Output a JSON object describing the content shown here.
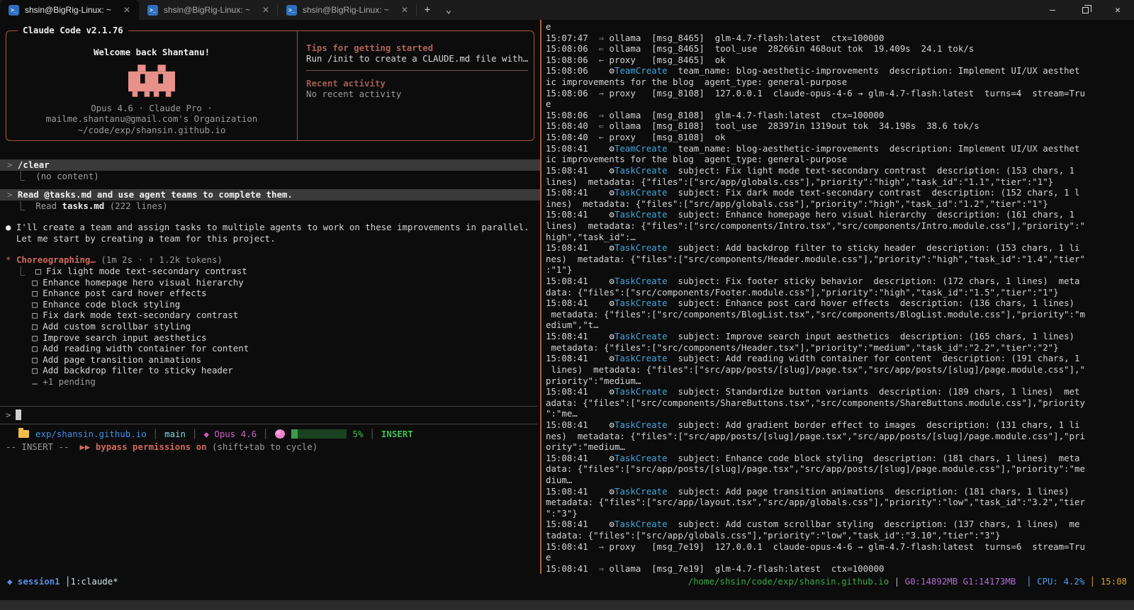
{
  "window": {
    "tabs": [
      {
        "title": "shsin@BigRig-Linux: ~",
        "active": true
      },
      {
        "title": "shsin@BigRig-Linux: ~",
        "active": false
      },
      {
        "title": "shsin@BigRig-Linux: ~",
        "active": false
      }
    ],
    "new_tab_label": "+",
    "tab_dropdown_label": "⌄",
    "minimize_label": "—",
    "close_label": "✕"
  },
  "icons": {
    "tab_terminal_icon": ">_",
    "prompt_chevron": ">",
    "result_elbow": "⎿",
    "assistant_bullet": "●",
    "spinner_star": "*",
    "task_checkbox": "□",
    "model_star": "◆",
    "session_diamond": "◆",
    "bypass_arrows": "▶▶"
  },
  "claude_box": {
    "title": "Claude Code v2.1.76",
    "welcome": "Welcome back Shantanu!",
    "model_line": "Opus 4.6 · Claude Pro ·",
    "org_line": "mailme.shantanu@gmail.com's Organization",
    "path_line": "~/code/exp/shansin.github.io",
    "tips_heading": "Tips for getting started",
    "tips_line": "Run /init to create a CLAUDE.md file with…",
    "recent_heading": "Recent activity",
    "recent_line": "No recent activity",
    "accent_color": "#a85340",
    "logo_color": "#e8908a"
  },
  "transcript": {
    "cmd1": "/clear",
    "cmd1_result": "(no content)",
    "cmd2": "Read @tasks.md and use agent teams to complete them.",
    "cmd2_result_prefix": "Read ",
    "cmd2_result_file": "tasks.md",
    "cmd2_result_suffix": " (222 lines)",
    "assistant_line1": "I'll create a team and assign tasks to multiple agents to work on these improvements in parallel.",
    "assistant_line2": "Let me start by creating a team for this project.",
    "spinner_verb": "Choreographing…",
    "spinner_meta": "(1m 2s · ↑ 1.2k tokens)",
    "tasks": [
      "Fix light mode text-secondary contrast",
      "Enhance homepage hero visual hierarchy",
      "Enhance post card hover effects",
      "Enhance code block styling",
      "Fix dark mode text-secondary contrast",
      "Add custom scrollbar styling",
      "Improve search input aesthetics",
      "Add reading width container for content",
      "Add page transition animations",
      "Add backdrop filter to sticky header"
    ],
    "tasks_more": "… +1 pending"
  },
  "statusline": {
    "repo": "exp/shansin.github.io",
    "branch": "main",
    "model": "Opus 4.6",
    "context_pct": "5%",
    "mode": "INSERT",
    "vim_mode": "-- INSERT --",
    "permissions": "bypass permissions on",
    "permissions_hint": "(shift+tab to cycle)",
    "accent_green": "#3fbf55",
    "accent_blue": "#3f8fe8",
    "accent_magenta": "#cf5fc4"
  },
  "tmux_bar": {
    "session": "session1",
    "window": "1:claude*",
    "path": "/home/shsin/code/exp/shansin.github.io",
    "gpu": "G0:14892MB G1:14173MB",
    "cpu": "CPU: 4.2%",
    "time": "15:08"
  },
  "log": {
    "lines": [
      [
        [
          "e",
          "fg"
        ]
      ],
      [
        [
          "15:07:47  ",
          "fg"
        ],
        [
          "⇒ ",
          "dim"
        ],
        [
          "ollama  [msg_8465]  glm-4.7-flash:latest  ctx=100000",
          "fg"
        ]
      ],
      [
        [
          "15:08:06  ",
          "fg"
        ],
        [
          "⇐ ",
          "dim"
        ],
        [
          "ollama  [msg_8465]  tool_use  28266in 468out tok  19.409s  24.1 tok/s",
          "fg"
        ]
      ],
      [
        [
          "15:08:06  ",
          "fg"
        ],
        [
          "← ",
          "dim"
        ],
        [
          "proxy   [msg_8465]  ok",
          "fg"
        ]
      ],
      [
        [
          "15:08:06    ",
          "fg"
        ],
        [
          "⚙",
          "gear"
        ],
        [
          "TeamCreate",
          "tool"
        ],
        [
          "  team_name: blog-aesthetic-improvements  description: Implement UI/UX aesthet",
          "fg"
        ]
      ],
      [
        [
          "ic improvements for the blog  agent_type: general-purpose",
          "fg"
        ]
      ],
      [
        [
          "15:08:06  ",
          "fg"
        ],
        [
          "→ ",
          "dim"
        ],
        [
          "proxy   [msg_8108]  127.0.0.1  claude-opus-4-6 → glm-4.7-flash:latest  turns=4  stream=Tru",
          "fg"
        ]
      ],
      [
        [
          "e",
          "fg"
        ]
      ],
      [
        [
          "15:08:06  ",
          "fg"
        ],
        [
          "⇒ ",
          "dim"
        ],
        [
          "ollama  [msg_8108]  glm-4.7-flash:latest  ctx=100000",
          "fg"
        ]
      ],
      [
        [
          "15:08:40  ",
          "fg"
        ],
        [
          "⇐ ",
          "dim"
        ],
        [
          "ollama  [msg_8108]  tool_use  28397in 1319out tok  34.198s  38.6 tok/s",
          "fg"
        ]
      ],
      [
        [
          "15:08:40  ",
          "fg"
        ],
        [
          "← ",
          "dim"
        ],
        [
          "proxy   [msg_8108]  ok",
          "fg"
        ]
      ],
      [
        [
          "15:08:41    ",
          "fg"
        ],
        [
          "⚙",
          "gear"
        ],
        [
          "TeamCreate",
          "tool"
        ],
        [
          "  team_name: blog-aesthetic-improvements  description: Implement UI/UX aesthet",
          "fg"
        ]
      ],
      [
        [
          "ic improvements for the blog  agent_type: general-purpose",
          "fg"
        ]
      ],
      [
        [
          "15:08:41    ",
          "fg"
        ],
        [
          "⚙",
          "gear"
        ],
        [
          "TaskCreate",
          "tool"
        ],
        [
          "  subject: Fix light mode text-secondary contrast  description: (153 chars, 1",
          "fg"
        ]
      ],
      [
        [
          "lines)  metadata: {\"files\":[\"src/app/globals.css\"],\"priority\":\"high\",\"task_id\":\"1.1\",\"tier\":\"1\"}",
          "fg"
        ]
      ],
      [
        [
          "15:08:41    ",
          "fg"
        ],
        [
          "⚙",
          "gear"
        ],
        [
          "TaskCreate",
          "tool"
        ],
        [
          "  subject: Fix dark mode text-secondary contrast  description: (152 chars, 1 l",
          "fg"
        ]
      ],
      [
        [
          "ines)  metadata: {\"files\":[\"src/app/globals.css\"],\"priority\":\"high\",\"task_id\":\"1.2\",\"tier\":\"1\"}",
          "fg"
        ]
      ],
      [
        [
          "15:08:41    ",
          "fg"
        ],
        [
          "⚙",
          "gear"
        ],
        [
          "TaskCreate",
          "tool"
        ],
        [
          "  subject: Enhance homepage hero visual hierarchy  description: (161 chars, 1",
          "fg"
        ]
      ],
      [
        [
          "lines)  metadata: {\"files\":[\"src/components/Intro.tsx\",\"src/components/Intro.module.css\"],\"priority\":\"",
          "fg"
        ]
      ],
      [
        [
          "high\",\"task_id\":…",
          "fg"
        ]
      ],
      [
        [
          "15:08:41    ",
          "fg"
        ],
        [
          "⚙",
          "gear"
        ],
        [
          "TaskCreate",
          "tool"
        ],
        [
          "  subject: Add backdrop filter to sticky header  description: (153 chars, 1 li",
          "fg"
        ]
      ],
      [
        [
          "nes)  metadata: {\"files\":[\"src/components/Header.module.css\"],\"priority\":\"high\",\"task_id\":\"1.4\",\"tier\"",
          "fg"
        ]
      ],
      [
        [
          ":\"1\"}",
          "fg"
        ]
      ],
      [
        [
          "15:08:41    ",
          "fg"
        ],
        [
          "⚙",
          "gear"
        ],
        [
          "TaskCreate",
          "tool"
        ],
        [
          "  subject: Fix footer sticky behavior  description: (172 chars, 1 lines)  meta",
          "fg"
        ]
      ],
      [
        [
          "data: {\"files\":[\"src/components/Footer.module.css\"],\"priority\":\"high\",\"task_id\":\"1.5\",\"tier\":\"1\"}",
          "fg"
        ]
      ],
      [
        [
          "15:08:41    ",
          "fg"
        ],
        [
          "⚙",
          "gear"
        ],
        [
          "TaskCreate",
          "tool"
        ],
        [
          "  subject: Enhance post card hover effects  description: (136 chars, 1 lines)",
          "fg"
        ]
      ],
      [
        [
          " metadata: {\"files\":[\"src/components/BlogList.tsx\",\"src/components/BlogList.module.css\"],\"priority\":\"m",
          "fg"
        ]
      ],
      [
        [
          "edium\",\"t…",
          "fg"
        ]
      ],
      [
        [
          "15:08:41    ",
          "fg"
        ],
        [
          "⚙",
          "gear"
        ],
        [
          "TaskCreate",
          "tool"
        ],
        [
          "  subject: Improve search input aesthetics  description: (165 chars, 1 lines)",
          "fg"
        ]
      ],
      [
        [
          " metadata: {\"files\":[\"src/components/Header.tsx\"],\"priority\":\"medium\",\"task_id\":\"2.2\",\"tier\":\"2\"}",
          "fg"
        ]
      ],
      [
        [
          "15:08:41    ",
          "fg"
        ],
        [
          "⚙",
          "gear"
        ],
        [
          "TaskCreate",
          "tool"
        ],
        [
          "  subject: Add reading width container for content  description: (191 chars, 1",
          "fg"
        ]
      ],
      [
        [
          " lines)  metadata: {\"files\":[\"src/app/posts/[slug]/page.tsx\",\"src/app/posts/[slug]/page.module.css\"],\"",
          "fg"
        ]
      ],
      [
        [
          "priority\":\"medium…",
          "fg"
        ]
      ],
      [
        [
          "15:08:41    ",
          "fg"
        ],
        [
          "⚙",
          "gear"
        ],
        [
          "TaskCreate",
          "tool"
        ],
        [
          "  subject: Standardize button variants  description: (189 chars, 1 lines)  met",
          "fg"
        ]
      ],
      [
        [
          "adata: {\"files\":[\"src/components/ShareButtons.tsx\",\"src/components/ShareButtons.module.css\"],\"priority",
          "fg"
        ]
      ],
      [
        [
          "\":\"me…",
          "fg"
        ]
      ],
      [
        [
          "15:08:41    ",
          "fg"
        ],
        [
          "⚙",
          "gear"
        ],
        [
          "TaskCreate",
          "tool"
        ],
        [
          "  subject: Add gradient border effect to images  description: (131 chars, 1 li",
          "fg"
        ]
      ],
      [
        [
          "nes)  metadata: {\"files\":[\"src/app/posts/[slug]/page.tsx\",\"src/app/posts/[slug]/page.module.css\"],\"pri",
          "fg"
        ]
      ],
      [
        [
          "ority\":\"medium…",
          "fg"
        ]
      ],
      [
        [
          "15:08:41    ",
          "fg"
        ],
        [
          "⚙",
          "gear"
        ],
        [
          "TaskCreate",
          "tool"
        ],
        [
          "  subject: Enhance code block styling  description: (181 chars, 1 lines)  meta",
          "fg"
        ]
      ],
      [
        [
          "data: {\"files\":[\"src/app/posts/[slug]/page.tsx\",\"src/app/posts/[slug]/page.module.css\"],\"priority\":\"me",
          "fg"
        ]
      ],
      [
        [
          "dium…",
          "fg"
        ]
      ],
      [
        [
          "15:08:41    ",
          "fg"
        ],
        [
          "⚙",
          "gear"
        ],
        [
          "TaskCreate",
          "tool"
        ],
        [
          "  subject: Add page transition animations  description: (181 chars, 1 lines)",
          "fg"
        ]
      ],
      [
        [
          "metadata: {\"files\":[\"src/app/layout.tsx\",\"src/app/globals.css\"],\"priority\":\"low\",\"task_id\":\"3.2\",\"tier",
          "fg"
        ]
      ],
      [
        [
          "\":\"3\"}",
          "fg"
        ]
      ],
      [
        [
          "15:08:41    ",
          "fg"
        ],
        [
          "⚙",
          "gear"
        ],
        [
          "TaskCreate",
          "tool"
        ],
        [
          "  subject: Add custom scrollbar styling  description: (137 chars, 1 lines)  me",
          "fg"
        ]
      ],
      [
        [
          "tadata: {\"files\":[\"src/app/globals.css\"],\"priority\":\"low\",\"task_id\":\"3.10\",\"tier\":\"3\"}",
          "fg"
        ]
      ],
      [
        [
          "15:08:41  ",
          "fg"
        ],
        [
          "→ ",
          "dim"
        ],
        [
          "proxy   [msg_7e19]  127.0.0.1  claude-opus-4-6 → glm-4.7-flash:latest  turns=6  stream=Tru",
          "fg"
        ]
      ],
      [
        [
          "e",
          "fg"
        ]
      ],
      [
        [
          "15:08:41  ",
          "fg"
        ],
        [
          "⇒ ",
          "dim"
        ],
        [
          "ollama  [msg_7e19]  glm-4.7-flash:latest  ctx=100000",
          "fg"
        ]
      ]
    ]
  }
}
